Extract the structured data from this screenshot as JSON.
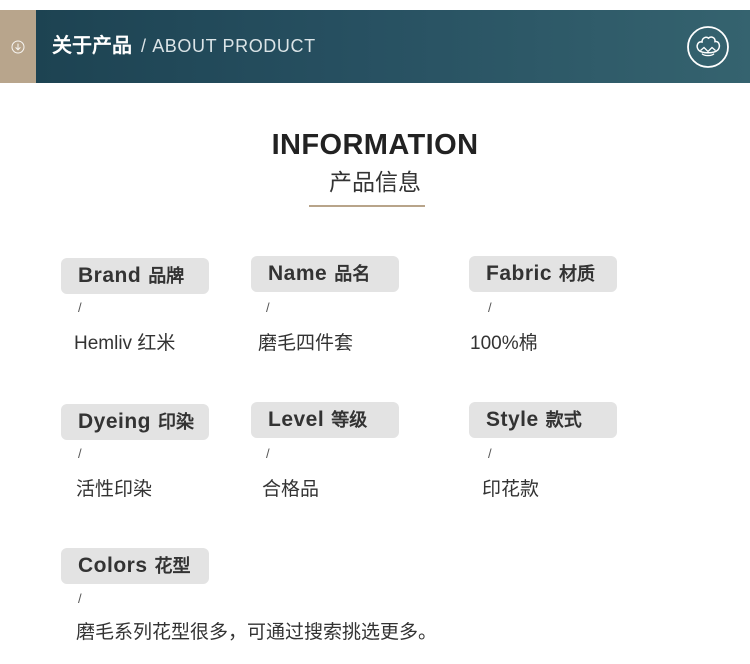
{
  "header": {
    "left_icon": "circle-down-arrow-icon",
    "title_cn": "关于产品",
    "title_en": "/ ABOUT PRODUCT",
    "right_icon": "cotton-flower-icon"
  },
  "info": {
    "title": "INFORMATION",
    "subtitle": "产品信息"
  },
  "items": [
    {
      "label_en": "Brand",
      "label_cn": "品牌",
      "separator": "/",
      "value": "Hemliv 红米"
    },
    {
      "label_en": "Name",
      "label_cn": "品名",
      "separator": "/",
      "value": "磨毛四件套"
    },
    {
      "label_en": "Fabric",
      "label_cn": "材质",
      "separator": "/",
      "value": "100%棉"
    },
    {
      "label_en": "Dyeing",
      "label_cn": "印染",
      "separator": "/",
      "value": "活性印染"
    },
    {
      "label_en": "Level",
      "label_cn": "等级",
      "separator": "/",
      "value": "合格品"
    },
    {
      "label_en": "Style",
      "label_cn": "款式",
      "separator": "/",
      "value": "印花款"
    },
    {
      "label_en": "Colors",
      "label_cn": "花型",
      "separator": "/",
      "value": "磨毛系列花型很多，可通过搜索挑选更多。"
    }
  ],
  "colors": {
    "header_bg": "#275061",
    "accent_tan": "#b8a48a",
    "label_bg": "#e3e3e3",
    "text": "#333333"
  }
}
